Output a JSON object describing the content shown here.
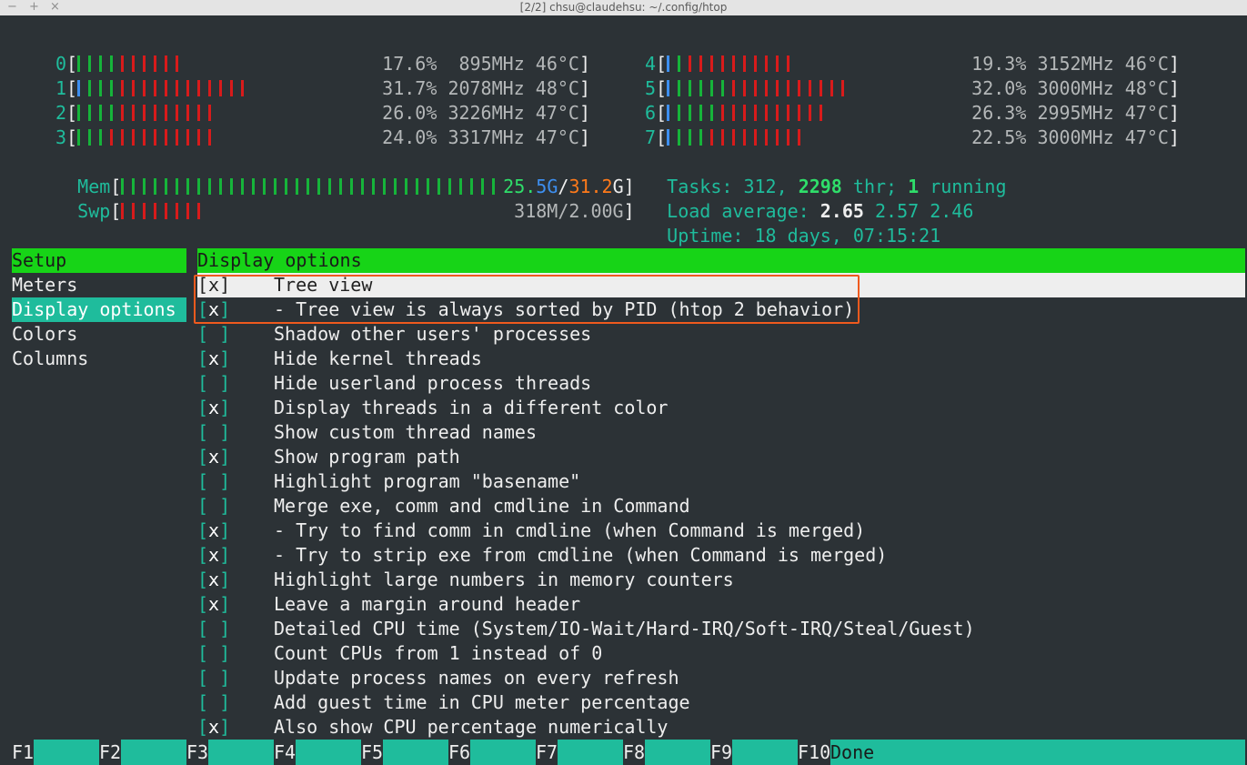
{
  "window": {
    "title": "[2/2] chsu@claudehsu: ~/.config/htop",
    "controls": [
      "−",
      "+",
      "×"
    ]
  },
  "cpus": [
    {
      "id": "0",
      "pct": "17.6%",
      "freq": "895MHz",
      "temp": "46°C",
      "bars": "ggggrrrrrr"
    },
    {
      "id": "1",
      "pct": "31.7%",
      "freq": "2078MHz",
      "temp": "48°C",
      "bars": "bgggrrrrrrrrrrrr"
    },
    {
      "id": "2",
      "pct": "26.0%",
      "freq": "3226MHz",
      "temp": "47°C",
      "bars": "ggggrrrrrrrrr"
    },
    {
      "id": "3",
      "pct": "24.0%",
      "freq": "3317MHz",
      "temp": "47°C",
      "bars": "gggrrrrrrrrrr"
    },
    {
      "id": "4",
      "pct": "19.3%",
      "freq": "3152MHz",
      "temp": "46°C",
      "bars": "bgrrrrrrrrrr"
    },
    {
      "id": "5",
      "pct": "32.0%",
      "freq": "3000MHz",
      "temp": "48°C",
      "bars": "bgggggrrrrrrrrrrr"
    },
    {
      "id": "6",
      "pct": "26.3%",
      "freq": "2995MHz",
      "temp": "47°C",
      "bars": "bggggrrrrrrrrrr"
    },
    {
      "id": "7",
      "pct": "22.5%",
      "freq": "3000MHz",
      "temp": "47°C",
      "bars": "bgggrrrrrrrrr"
    }
  ],
  "mem": {
    "label": "Mem",
    "used": "25.5G",
    "used_a": "25.",
    "used_b": "5G",
    "sep": "/",
    "total": "31.2G",
    "unit_tail": "G",
    "total_a": "31.2",
    "bars": 35
  },
  "swp": {
    "label": "Swp",
    "value": "318M/2.00G",
    "bars": 8
  },
  "tasks": {
    "label": "Tasks:",
    "count": "312",
    "threads": "2298",
    "thr_label": "thr;",
    "running": "1",
    "running_label": "running"
  },
  "load": {
    "label": "Load average:",
    "one": "2.65",
    "five": "2.57",
    "fifteen": "2.46"
  },
  "uptime": {
    "label": "Uptime:",
    "value": "18 days, 07:15:21"
  },
  "setup": {
    "header": "Setup",
    "items": [
      "Meters",
      "Display options",
      "Colors",
      "Columns"
    ],
    "selected_index": 1
  },
  "display": {
    "header": "Display options",
    "options": [
      {
        "checked": true,
        "label": "Tree view"
      },
      {
        "checked": true,
        "label": "- Tree view is always sorted by PID (htop 2 behavior)"
      },
      {
        "checked": false,
        "label": "Shadow other users' processes"
      },
      {
        "checked": true,
        "label": "Hide kernel threads"
      },
      {
        "checked": false,
        "label": "Hide userland process threads"
      },
      {
        "checked": true,
        "label": "Display threads in a different color"
      },
      {
        "checked": false,
        "label": "Show custom thread names"
      },
      {
        "checked": true,
        "label": "Show program path"
      },
      {
        "checked": false,
        "label": "Highlight program \"basename\""
      },
      {
        "checked": false,
        "label": "Merge exe, comm and cmdline in Command"
      },
      {
        "checked": true,
        "label": "- Try to find comm in cmdline (when Command is merged)"
      },
      {
        "checked": true,
        "label": "- Try to strip exe from cmdline (when Command is merged)"
      },
      {
        "checked": true,
        "label": "Highlight large numbers in memory counters"
      },
      {
        "checked": true,
        "label": "Leave a margin around header"
      },
      {
        "checked": false,
        "label": "Detailed CPU time (System/IO-Wait/Hard-IRQ/Soft-IRQ/Steal/Guest)"
      },
      {
        "checked": false,
        "label": "Count CPUs from 1 instead of 0"
      },
      {
        "checked": false,
        "label": "Update process names on every refresh"
      },
      {
        "checked": false,
        "label": "Add guest time in CPU meter percentage"
      },
      {
        "checked": true,
        "label": "Also show CPU percentage numerically"
      }
    ],
    "selected_index": 0
  },
  "fkeys": [
    {
      "key": "F1",
      "action": ""
    },
    {
      "key": "F2",
      "action": ""
    },
    {
      "key": "F3",
      "action": ""
    },
    {
      "key": "F4",
      "action": ""
    },
    {
      "key": "F5",
      "action": ""
    },
    {
      "key": "F6",
      "action": ""
    },
    {
      "key": "F7",
      "action": ""
    },
    {
      "key": "F8",
      "action": ""
    },
    {
      "key": "F9",
      "action": ""
    },
    {
      "key": "F10",
      "action": "Done"
    }
  ],
  "colors": {
    "accent": "#1fbc9c",
    "header_green": "#17d417",
    "highlight_box": "#ef5a1e",
    "bg": "#2c3236"
  }
}
